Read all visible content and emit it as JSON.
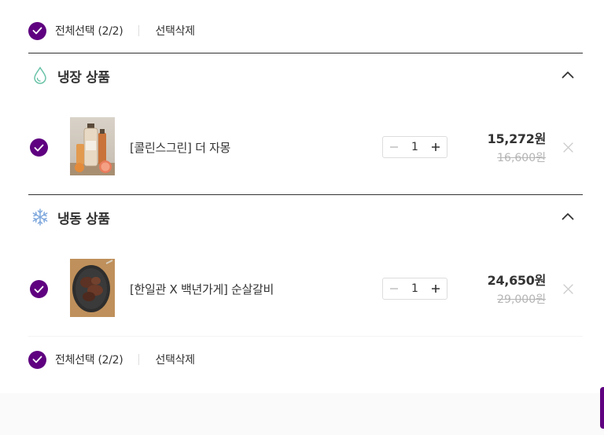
{
  "select_bar_top": {
    "label": "전체선택 (2/2)",
    "delete_label": "선택삭제"
  },
  "sections": [
    {
      "title": "냉장 상품",
      "icon": "water-drop-icon",
      "items": [
        {
          "name": "[콜린스그린] 더 자몽",
          "quantity": "1",
          "price": "15,272원",
          "original_price": "16,600원"
        }
      ]
    },
    {
      "title": "냉동 상품",
      "icon": "snowflake-icon",
      "items": [
        {
          "name": "[한일관 X 백년가게] 순살갈비",
          "quantity": "1",
          "price": "24,650원",
          "original_price": "29,000원"
        }
      ]
    }
  ],
  "select_bar_bottom": {
    "label": "전체선택 (2/2)",
    "delete_label": "선택삭제"
  },
  "colors": {
    "accent": "#5f0080",
    "divider": "#333333",
    "muted": "#b5b5b5",
    "drop": "#6ac3a8",
    "snow": "#7fa8dd"
  }
}
